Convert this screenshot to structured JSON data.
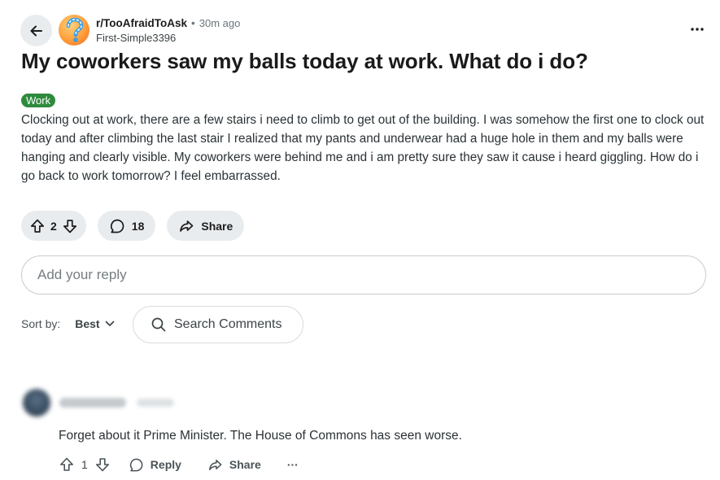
{
  "post": {
    "subreddit": "r/TooAfraidToAsk",
    "separator": "•",
    "time": "30m ago",
    "author": "First-Simple3396",
    "title": "My coworkers saw my balls today at work. What do i do?",
    "flair": "Work",
    "body": "Clocking out at work, there are a few stairs i need to climb to get out of the building. I was somehow the first one to clock out today and after climbing the last stair I realized that my pants and underwear had a huge hole in them and my balls were hanging and clearly visible. My coworkers were behind me and i am pretty sure they saw it cause i heard giggling. How do i go back to work tomorrow? I feel embarrassed.",
    "score": "2",
    "comments": "18",
    "share_label": "Share"
  },
  "reply": {
    "placeholder": "Add your reply"
  },
  "sort": {
    "label": "Sort by:",
    "value": "Best"
  },
  "search": {
    "placeholder": "Search Comments"
  },
  "comment": {
    "text": "Forget about it Prime Minister. The House of Commons has seen worse.",
    "score": "1",
    "reply_label": "Reply",
    "share_label": "Share",
    "more_label": "···"
  },
  "colors": {
    "flair": "#2e8b3e",
    "pill_bg": "#e9ecee",
    "border": "#c6cbce"
  },
  "icons": [
    "back-arrow-icon",
    "more-icon",
    "upvote-icon",
    "downvote-icon",
    "comment-icon",
    "share-icon",
    "search-icon",
    "chevron-down-icon"
  ]
}
